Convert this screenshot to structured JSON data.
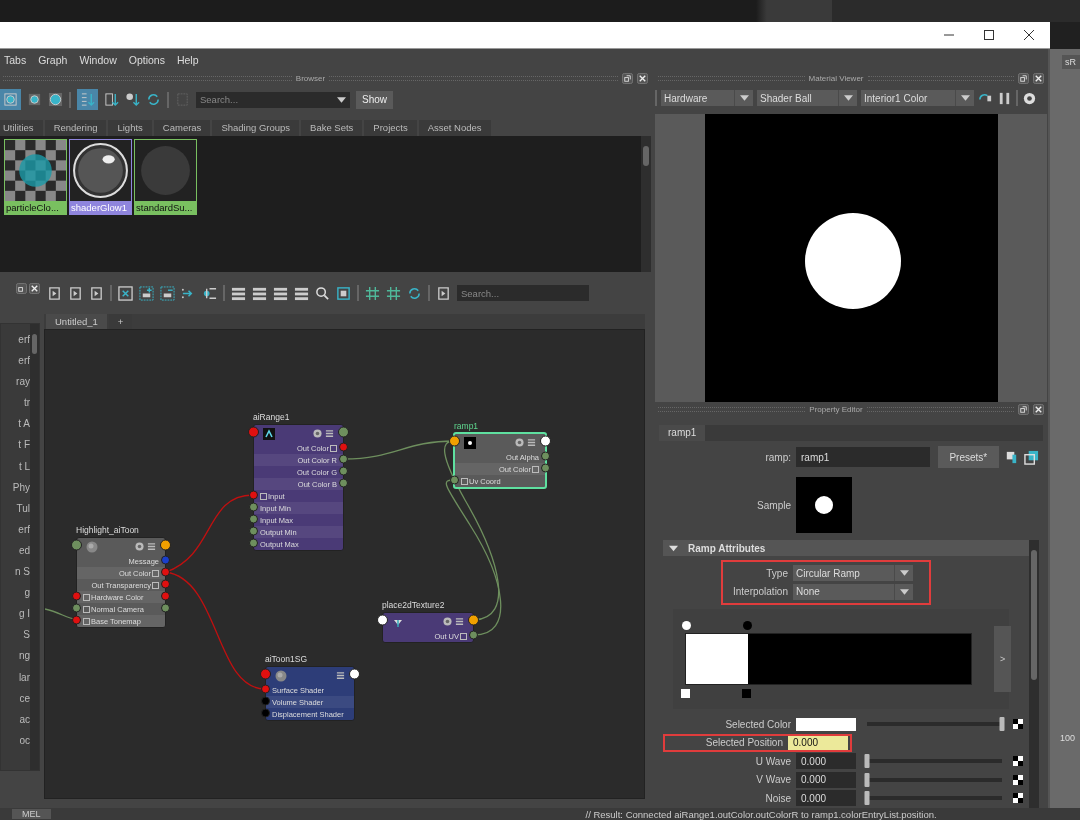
{
  "window": {
    "menu": [
      "Tabs",
      "Graph",
      "Window",
      "Options",
      "Help"
    ]
  },
  "browser": {
    "title": "Browser",
    "search": {
      "placeholder": "Search..."
    },
    "show_button": "Show",
    "tabs": [
      "Utilities",
      "Rendering",
      "Lights",
      "Cameras",
      "Shading Groups",
      "Bake Sets",
      "Projects",
      "Asset Nodes"
    ],
    "swatches": [
      {
        "label": "particleClo...",
        "kind": "checker",
        "selected": false
      },
      {
        "label": "shaderGlow1",
        "kind": "glossy",
        "selected": true
      },
      {
        "label": "standardSu...",
        "kind": "matte",
        "selected": false
      }
    ]
  },
  "node_editor": {
    "search": {
      "placeholder": "Search..."
    },
    "tabs": [
      {
        "label": "Untitled_1",
        "selected": true
      },
      {
        "label": "+",
        "selected": false
      }
    ],
    "side_list": [
      "erf",
      "erf",
      "ray",
      "tr",
      "t A",
      "t F",
      "t L",
      "Phy",
      "Tul",
      "erf",
      "ed",
      "n S",
      "g",
      "g I",
      "S",
      "ng",
      "lar",
      "ce",
      "ac",
      "oc"
    ],
    "nodes": [
      {
        "title": "aiRange1",
        "kind": "utility",
        "selected": false,
        "in_port": {
          "color": "#e01010"
        },
        "out_port": {
          "color": "#6e8f5e"
        },
        "rows": [
          {
            "label": "Out Color",
            "out_port": {
              "color": "#e01010"
            },
            "expandable": true
          },
          {
            "label": "Out Color R",
            "out_port": {
              "color": "#6e8f5e"
            },
            "expandable": false
          },
          {
            "label": "Out Color G",
            "out_port": {
              "color": "#6e8f5e"
            },
            "expandable": false
          },
          {
            "label": "Out Color B",
            "out_port": {
              "color": "#6e8f5e"
            },
            "expandable": false
          },
          {
            "label": "Input",
            "in_port": {
              "color": "#e01010"
            },
            "expandable": true
          },
          {
            "label": "Input Min",
            "in_port": {
              "color": "#6e8f5e"
            },
            "expandable": false
          },
          {
            "label": "Input Max",
            "in_port": {
              "color": "#6e8f5e"
            },
            "expandable": false
          },
          {
            "label": "Output Min",
            "in_port": {
              "color": "#6e8f5e"
            },
            "expandable": false
          },
          {
            "label": "Output Max",
            "in_port": {
              "color": "#6e8f5e"
            },
            "expandable": false
          }
        ]
      },
      {
        "title": "ramp1",
        "kind": "texture",
        "selected": true,
        "in_port": {
          "color": "#f0a000"
        },
        "out_port": {
          "color": "#ffffff"
        },
        "rows": [
          {
            "label": "Out Alpha",
            "out_port": {
              "color": "#6e8f5e"
            },
            "expandable": false
          },
          {
            "label": "Out Color",
            "out_port": {
              "color": "#6e8f5e"
            },
            "expandable": true
          },
          {
            "label": "Uv Coord",
            "in_port": {
              "color": "#6e8f5e"
            },
            "expandable": true
          }
        ]
      },
      {
        "title": "Highlight_aiToon",
        "kind": "shader",
        "selected": false,
        "in_port": {
          "color": "#6e8f5e"
        },
        "out_port": {
          "color": "#f0a000"
        },
        "rows": [
          {
            "label": "Message",
            "out_port": {
              "color": "#1a3fcc"
            },
            "expandable": false
          },
          {
            "label": "Out Color",
            "out_port": {
              "color": "#e01010"
            },
            "expandable": true
          },
          {
            "label": "Out Transparency",
            "out_port": {
              "color": "#e01010"
            },
            "expandable": true
          },
          {
            "label": "Hardware Color",
            "in_port": {
              "color": "#e01010"
            },
            "out_port": {
              "color": "#e01010"
            },
            "expandable": true
          },
          {
            "label": "Normal Camera",
            "in_port": {
              "color": "#6e8f5e"
            },
            "out_port": {
              "color": "#6e8f5e"
            },
            "expandable": true
          },
          {
            "label": "Base Tonemap",
            "in_port": {
              "color": "#e01010"
            },
            "expandable": true
          }
        ]
      },
      {
        "title": "place2dTexture2",
        "kind": "placement",
        "selected": false,
        "in_port": {
          "color": "#ffffff"
        },
        "out_port": {
          "color": "#f0a000"
        },
        "rows": [
          {
            "label": "Out UV",
            "out_port": {
              "color": "#6e8f5e"
            },
            "expandable": true
          }
        ]
      },
      {
        "title": "aiToon1SG",
        "kind": "shading_group",
        "selected": false,
        "in_port": {
          "color": "#e01010"
        },
        "out_port": {
          "color": "#ffffff"
        },
        "rows": [
          {
            "label": "Surface Shader",
            "in_port": {
              "color": "#e01010"
            },
            "expandable": false
          },
          {
            "label": "Volume Shader",
            "in_port": {
              "color": "#000000"
            },
            "expandable": false
          },
          {
            "label": "Displacement Shader",
            "in_port": {
              "color": "#000000"
            },
            "expandable": false
          }
        ]
      }
    ]
  },
  "material_viewer": {
    "title": "Material Viewer",
    "renderer": "Hardware",
    "geometry": "Shader Ball",
    "environment": "Interior1 Color"
  },
  "property_editor": {
    "title": "Property Editor",
    "tab": "ramp1",
    "name_label": "ramp:",
    "name_value": "ramp1",
    "presets_button": "Presets*",
    "sample_label": "Sample",
    "section": {
      "title": "Ramp Attributes",
      "expanded": true
    },
    "ramp_settings": {
      "highlighted": true,
      "type": {
        "label": "Type",
        "value": "Circular Ramp"
      },
      "interpolation": {
        "label": "Interpolation",
        "value": "None"
      }
    },
    "ramp_button": ">",
    "selected_color": {
      "label": "Selected Color",
      "level": 1
    },
    "selected_position": {
      "label": "Selected Position",
      "value": "0.000",
      "highlighted": true
    },
    "attributes": [
      {
        "label": "U Wave",
        "value": "0.000",
        "level": 0
      },
      {
        "label": "V Wave",
        "value": "0.000",
        "level": 0
      },
      {
        "label": "Noise",
        "value": "0.000",
        "level": 0
      }
    ]
  },
  "side_panel": {
    "button": "sR",
    "timeline_label": "100"
  },
  "status_bar": {
    "mode": "MEL",
    "result": "// Result: Connected aiRange1.outColor.outColorR to ramp1.colorEntryList.position."
  }
}
